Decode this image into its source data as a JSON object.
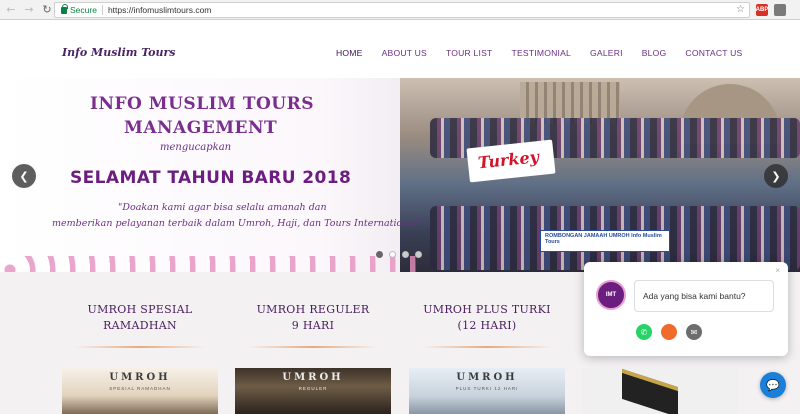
{
  "browser": {
    "secure_label": "Secure",
    "url": "https://infomuslimtours.com",
    "ext1_label": "ABP"
  },
  "site": {
    "logo": "Info Muslim Tours",
    "menu": [
      "HOME",
      "ABOUT US",
      "TOUR LIST",
      "TESTIMONIAL",
      "GALERI",
      "BLOG",
      "CONTACT US"
    ]
  },
  "slide": {
    "title_line1": "INFO MUSLIM TOURS",
    "title_line2": "MANAGEMENT",
    "subtitle": "mengucapkan",
    "headline": "SELAMAT TAHUN BARU 2018",
    "quote_line1": "\"Doakan kami agar bisa selalu amanah dan",
    "quote_line2": "memberikan pelayanan terbaik dalam Umroh, Haji, dan Tours International\"",
    "banner_turkey": "Turkey",
    "banner_rombongan": "ROMBONGAN JAMAAH UMROH Info Muslim Tours",
    "dots": 4,
    "active_dot": 0
  },
  "packages": [
    {
      "title_line1": "UMROH SPESIAL",
      "title_line2": "RAMADHAN",
      "thumb_title": "UMROH",
      "thumb_sub": "SPESIAL RAMADHAN"
    },
    {
      "title_line1": "UMROH REGULER",
      "title_line2": "9 HARI",
      "thumb_title": "UMROH",
      "thumb_sub": "REGULER"
    },
    {
      "title_line1": "UMROH PLUS TURKI",
      "title_line2": "(12 HARI)",
      "thumb_title": "UMROH",
      "thumb_sub": "PLUS TURKI 12 HARI"
    }
  ],
  "chat": {
    "message": "Ada yang bisa kami bantu?",
    "close": "×",
    "avatar_text": "IMT"
  },
  "icons": {
    "back": "←",
    "forward": "→",
    "reload": "↻",
    "star": "☆",
    "prev": "❮",
    "next": "❯",
    "whatsapp": "✆",
    "email": "✉",
    "chat": "💬"
  },
  "colors": {
    "brand_purple": "#6b2f86",
    "secure_green": "#0b8043",
    "whatsapp": "#25d366",
    "chat_blue": "#1a7fd8"
  }
}
